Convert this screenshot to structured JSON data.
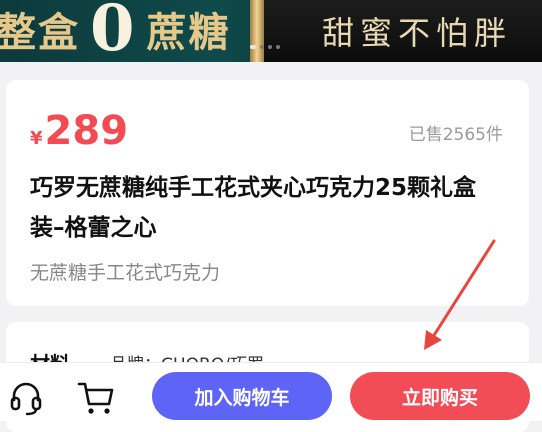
{
  "banner": {
    "left_text_a": "整盒",
    "left_zero": "0",
    "left_text_b": "蔗糖",
    "right_text": "甜蜜不怕胖"
  },
  "product": {
    "currency_symbol": "¥",
    "price": "289",
    "sold": "已售2565件",
    "title": "巧罗无蔗糖纯手工花式夹心巧克力25颗礼盒装–格蕾之心",
    "subtitle": "无蔗糖手工花式巧克力"
  },
  "specs": {
    "key": "材料",
    "value": "品牌：CHORO/巧罗"
  },
  "bottom_bar": {
    "add_to_cart": "加入购物车",
    "buy_now": "立即购买",
    "service_icon": "headset-icon",
    "cart_icon": "cart-icon"
  },
  "colors": {
    "price": "#f44a52",
    "add_to_cart_button": "#5e64f6",
    "buy_now_button": "#f24d56",
    "annotation_arrow": "#e8453c"
  }
}
